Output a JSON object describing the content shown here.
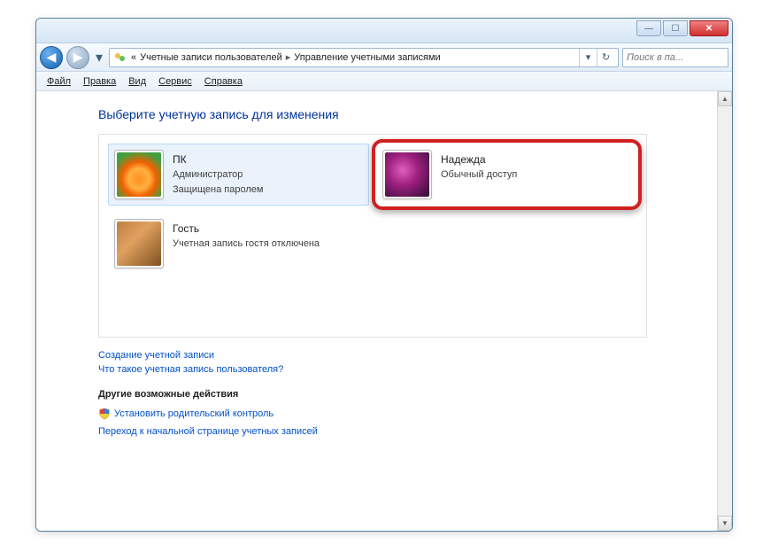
{
  "titlebar": {
    "min": "—",
    "max": "☐",
    "close": "✕"
  },
  "nav": {
    "back": "◀",
    "fwd": "▶",
    "drop": "▾",
    "chevrons": "«",
    "crumb1": "Учетные записи пользователей",
    "sep": "▸",
    "crumb2": "Управление учетными записями",
    "refresh_dd": "▾",
    "refresh": "↻"
  },
  "search": {
    "placeholder": "Поиск в па...",
    "icon": "🔍"
  },
  "menu": {
    "file": "Файл",
    "edit": "Правка",
    "view": "Вид",
    "tools": "Сервис",
    "help": "Справка"
  },
  "heading": "Выберите учетную запись для изменения",
  "accounts": {
    "pk": {
      "name": "ПК",
      "role": "Администратор",
      "status": "Защищена паролем"
    },
    "nadezhda": {
      "name": "Надежда",
      "role": "Обычный доступ"
    },
    "guest": {
      "name": "Гость",
      "status": "Учетная запись гостя отключена"
    }
  },
  "links": {
    "create": "Создание учетной записи",
    "what": "Что такое учетная запись пользователя?"
  },
  "other": {
    "heading": "Другие возможные действия",
    "parental": "Установить родительский контроль",
    "gohome": "Переход к начальной странице учетных записей"
  }
}
